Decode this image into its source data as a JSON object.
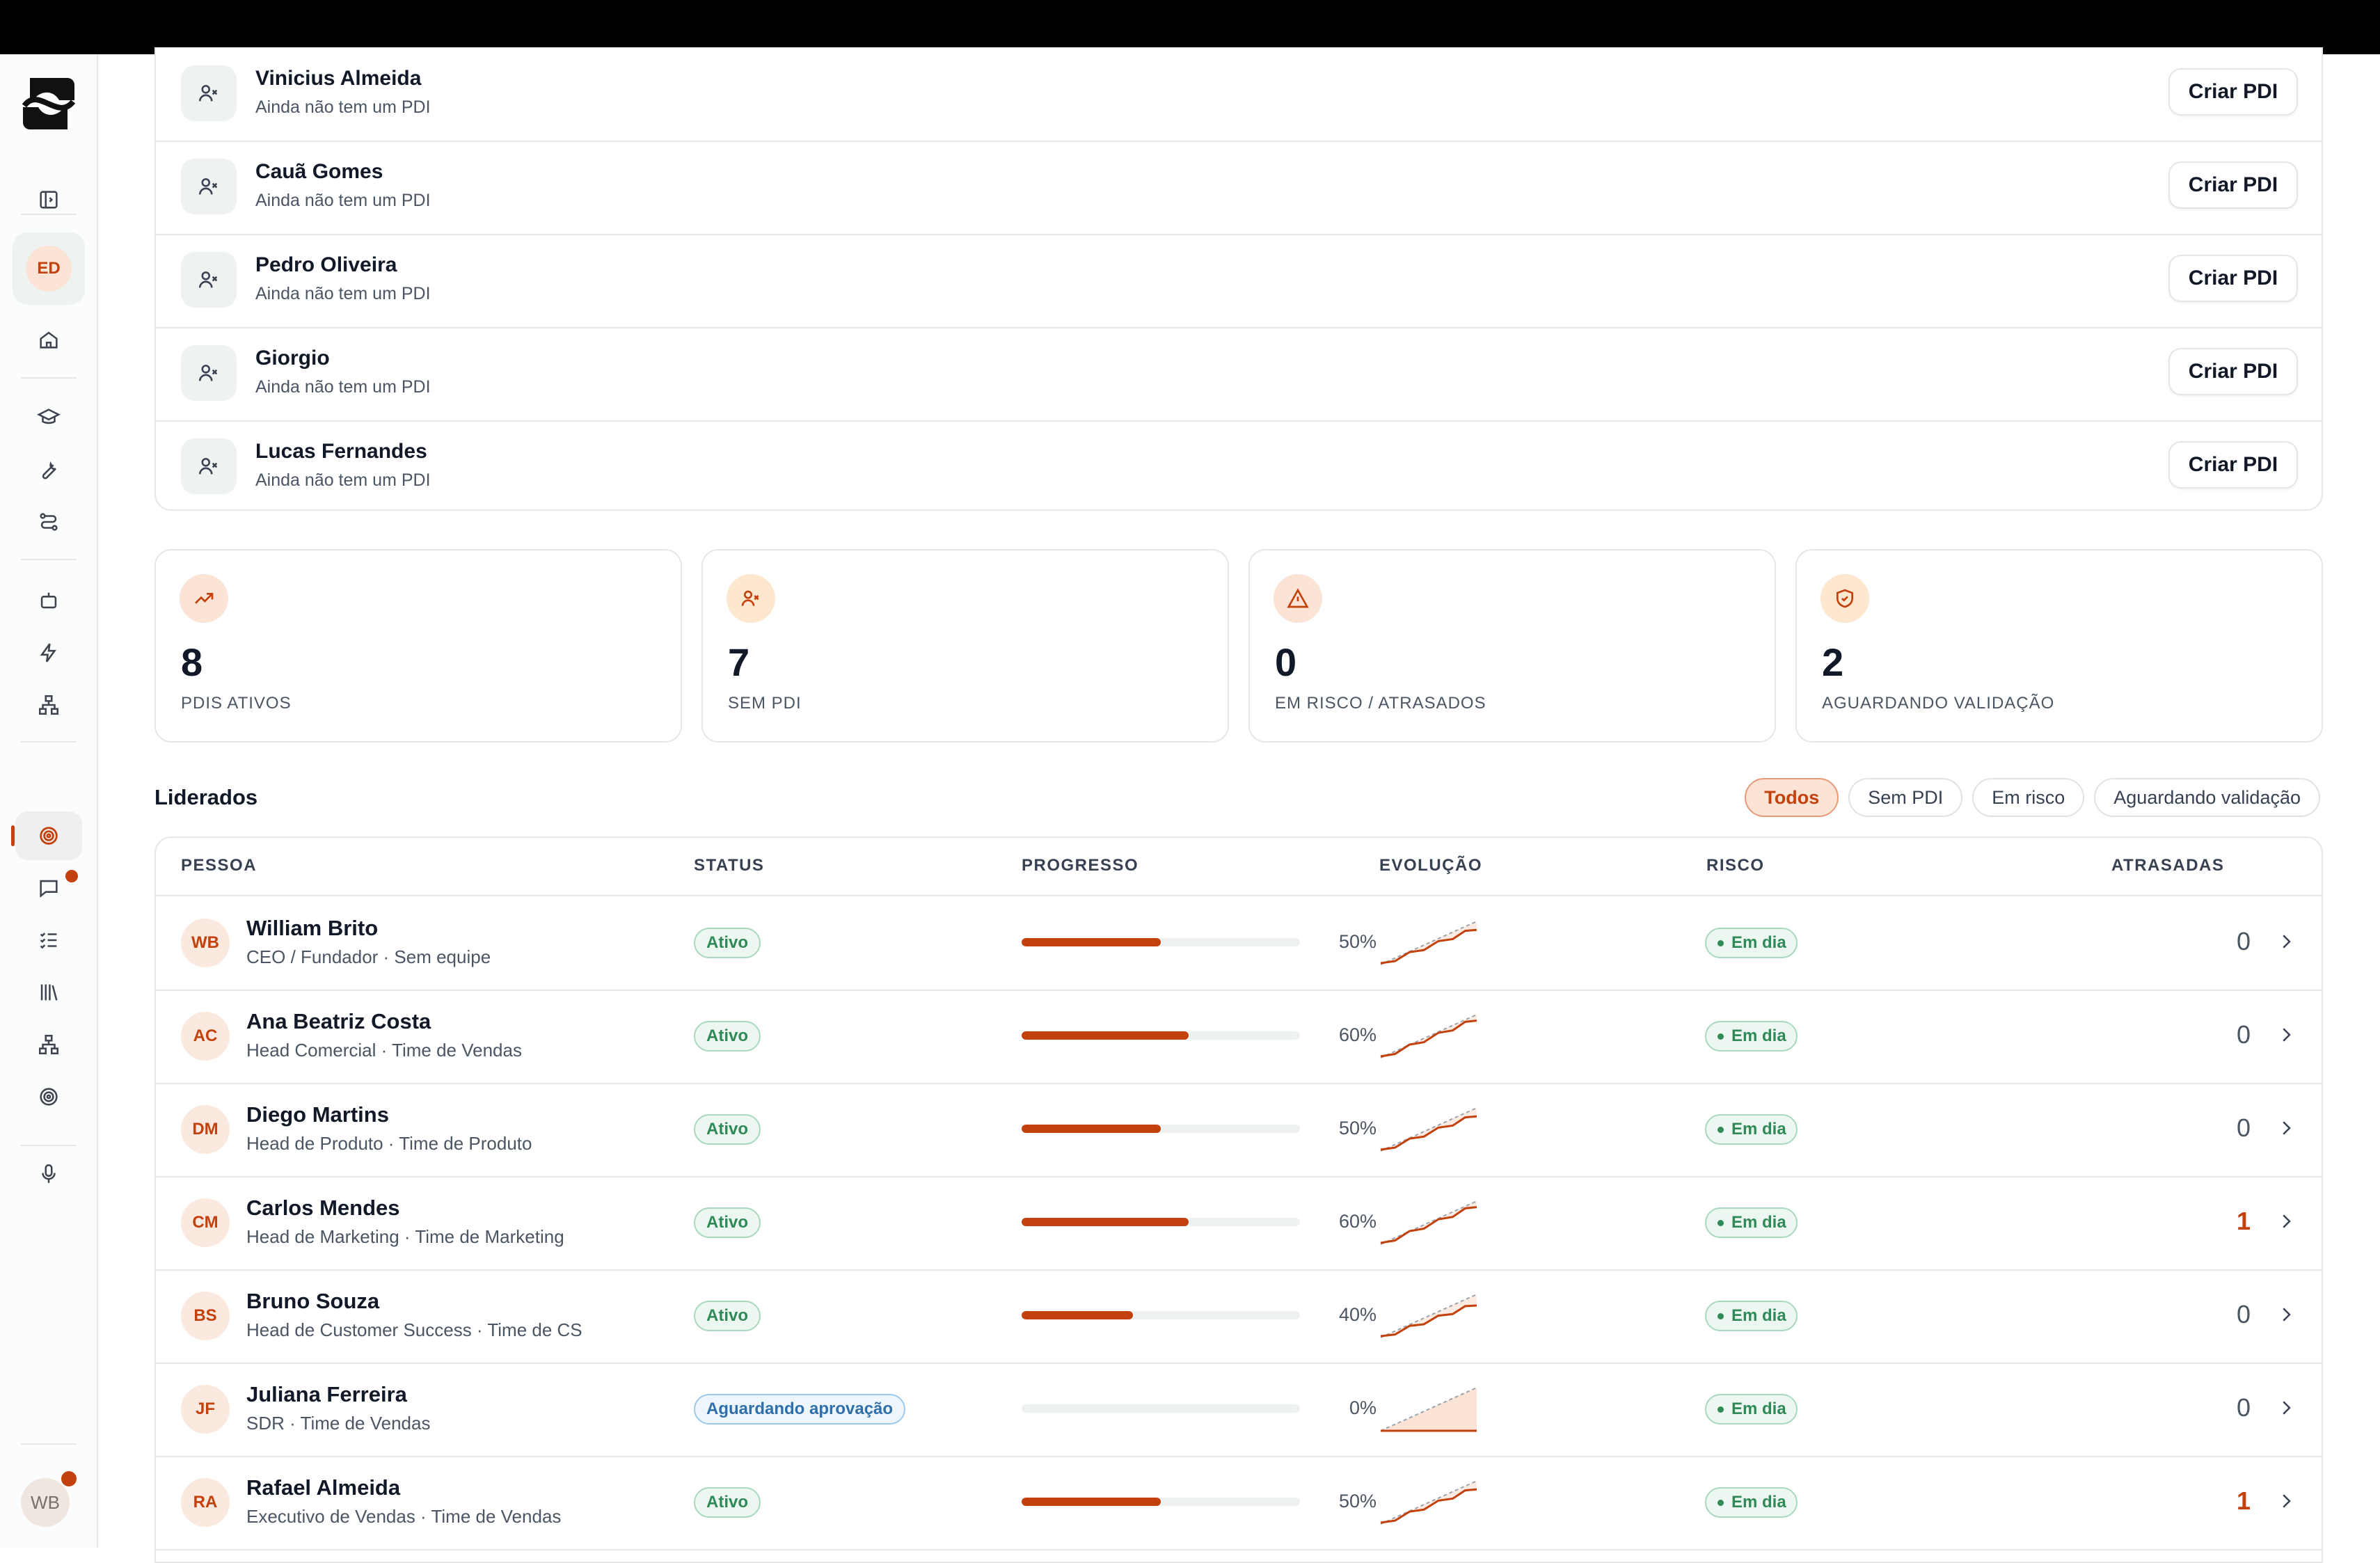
{
  "sidebar": {
    "user_initials": "ED",
    "bottom_initials": "WB"
  },
  "no_pdi_list": [
    {
      "name": "Vinicius Almeida",
      "subtitle": "Ainda não tem um PDI",
      "action": "Criar PDI"
    },
    {
      "name": "Cauã Gomes",
      "subtitle": "Ainda não tem um PDI",
      "action": "Criar PDI"
    },
    {
      "name": "Pedro Oliveira",
      "subtitle": "Ainda não tem um PDI",
      "action": "Criar PDI"
    },
    {
      "name": "Giorgio",
      "subtitle": "Ainda não tem um PDI",
      "action": "Criar PDI"
    },
    {
      "name": "Lucas Fernandes",
      "subtitle": "Ainda não tem um PDI",
      "action": "Criar PDI"
    }
  ],
  "stats": [
    {
      "value": "8",
      "label": "PDIS ATIVOS",
      "icon": "trending-up-icon"
    },
    {
      "value": "7",
      "label": "SEM PDI",
      "icon": "user-x-icon"
    },
    {
      "value": "0",
      "label": "EM RISCO / ATRASADOS",
      "icon": "alert-triangle-icon"
    },
    {
      "value": "2",
      "label": "AGUARDANDO VALIDAÇÃO",
      "icon": "shield-check-icon"
    }
  ],
  "section": {
    "title": "Liderados"
  },
  "filters": [
    "Todos",
    "Sem PDI",
    "Em risco",
    "Aguardando validação"
  ],
  "table": {
    "headers": [
      "PESSOA",
      "STATUS",
      "PROGRESSO",
      "EVOLUÇÃO",
      "RISCO",
      "ATRASADAS"
    ],
    "rows": [
      {
        "initials": "WB",
        "name": "William Brito",
        "role": "CEO / Fundador · Sem equipe",
        "status": "Ativo",
        "progress": 50,
        "progress_label": "50%",
        "risk": "Em dia",
        "late": "0"
      },
      {
        "initials": "AC",
        "name": "Ana Beatriz Costa",
        "role": "Head Comercial · Time de Vendas",
        "status": "Ativo",
        "progress": 60,
        "progress_label": "60%",
        "risk": "Em dia",
        "late": "0"
      },
      {
        "initials": "DM",
        "name": "Diego Martins",
        "role": "Head de Produto · Time de Produto",
        "status": "Ativo",
        "progress": 50,
        "progress_label": "50%",
        "risk": "Em dia",
        "late": "0"
      },
      {
        "initials": "CM",
        "name": "Carlos Mendes",
        "role": "Head de Marketing · Time de Marketing",
        "status": "Ativo",
        "progress": 60,
        "progress_label": "60%",
        "risk": "Em dia",
        "late": "1"
      },
      {
        "initials": "BS",
        "name": "Bruno Souza",
        "role": "Head de Customer Success · Time de CS",
        "status": "Ativo",
        "progress": 40,
        "progress_label": "40%",
        "risk": "Em dia",
        "late": "0"
      },
      {
        "initials": "JF",
        "name": "Juliana Ferreira",
        "role": "SDR · Time de Vendas",
        "status": "Aguardando aprovação",
        "progress": 0,
        "progress_label": "0%",
        "risk": "Em dia",
        "late": "0"
      },
      {
        "initials": "RA",
        "name": "Rafael Almeida",
        "role": "Executivo de Vendas · Time de Vendas",
        "status": "Ativo",
        "progress": 50,
        "progress_label": "50%",
        "risk": "Em dia",
        "late": "1"
      }
    ]
  },
  "colors": {
    "accent": "#c2410c",
    "success": "#2f8a57",
    "info": "#2f6ea8"
  }
}
